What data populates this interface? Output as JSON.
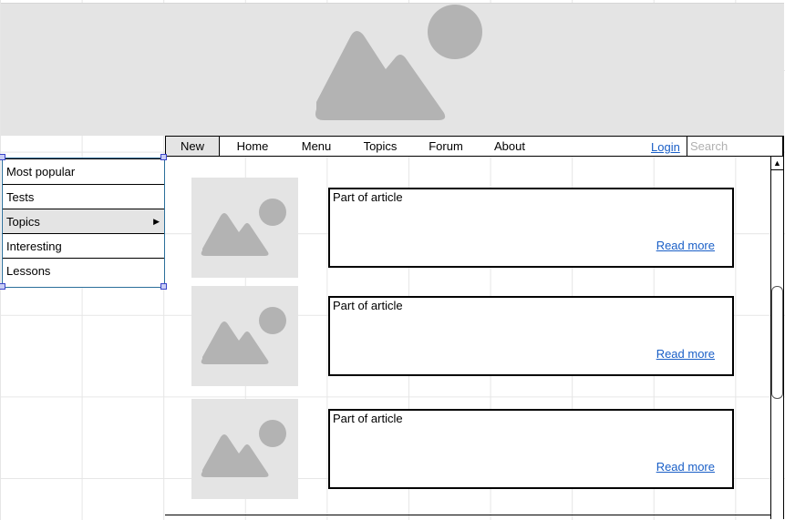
{
  "navbar": {
    "items": [
      {
        "label": "New",
        "active": true
      },
      {
        "label": "Home"
      },
      {
        "label": "Menu"
      },
      {
        "label": "Topics"
      },
      {
        "label": "Forum"
      },
      {
        "label": "About"
      }
    ],
    "login_label": "Login",
    "search_placeholder": "Search"
  },
  "sidemenu": {
    "items": [
      {
        "label": "Most popular"
      },
      {
        "label": "Tests"
      },
      {
        "label": "Topics",
        "has_submenu": true,
        "highlighted": true
      },
      {
        "label": "Interesting"
      },
      {
        "label": "Lessons"
      }
    ],
    "submenu_arrow": "▶"
  },
  "articles": [
    {
      "text": "Part of article",
      "link": "Read more"
    },
    {
      "text": "Part of article",
      "link": "Read more"
    },
    {
      "text": "Part of article",
      "link": "Read more"
    }
  ],
  "scrollbar": {
    "up_arrow": "▲"
  },
  "colors": {
    "placeholder_fill": "#e4e4e4",
    "placeholder_icon": "#b3b3b3",
    "link": "#1a5fc7",
    "menu_highlight": "#e4e4e4"
  },
  "icons": {
    "banner": "image-placeholder-icon",
    "thumb": "image-placeholder-icon"
  }
}
